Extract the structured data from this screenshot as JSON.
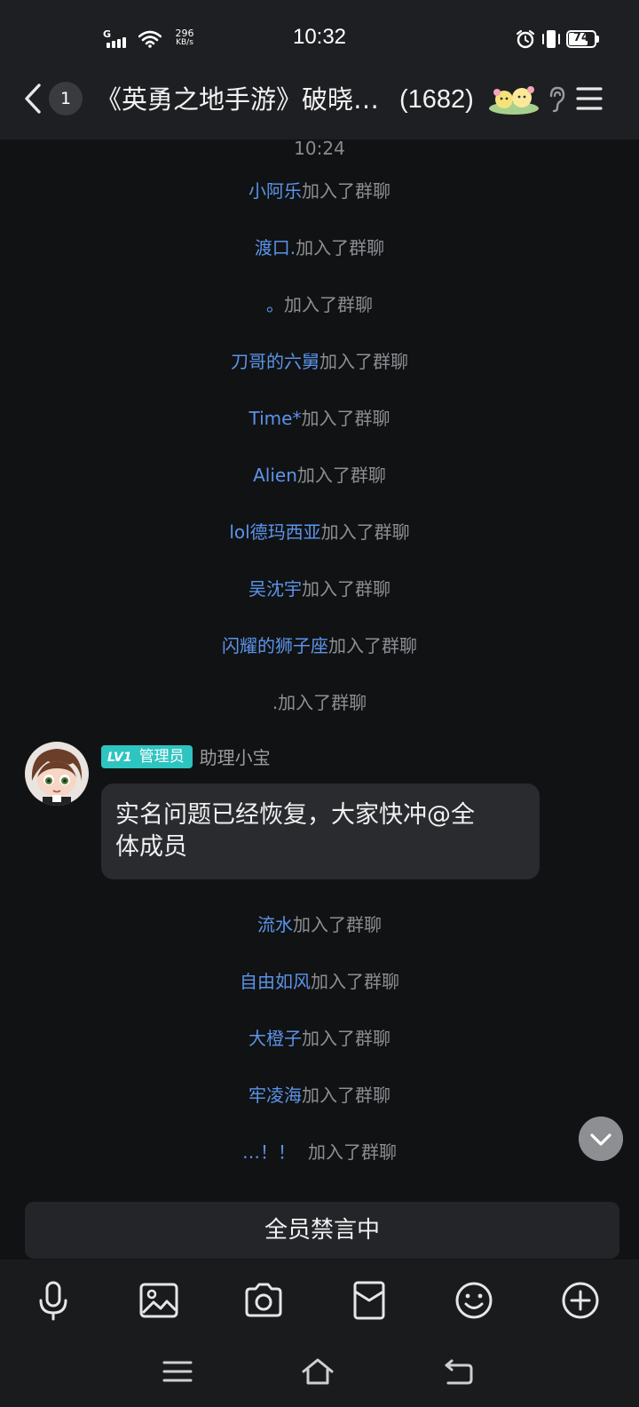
{
  "status_bar": {
    "network": "G",
    "net_speed": "296",
    "net_speed_unit": "KB/s",
    "time": "10:32",
    "battery": "74",
    "battery_level": 0.74
  },
  "title_bar": {
    "unread_count": "1",
    "group_name": "《英勇之地手游》破晓…",
    "member_count": "(1682)"
  },
  "chat": {
    "timestamp": "10:24",
    "join_suffix": "加入了群聊",
    "joins_before": [
      "小阿乐",
      "渡口.",
      "。",
      "刀哥的六舅",
      "Time*",
      "Alien",
      "lol德玛西亚",
      "吴沈宇",
      "闪耀的狮子座",
      "."
    ],
    "message": {
      "level": "LV1",
      "role": "管理员",
      "sender": "助理小宝",
      "text_line1": "实名问题已经恢复，大家快冲@全",
      "text_line2": "体成员"
    },
    "joins_after": [
      "流水",
      "自由如风",
      "大橙子",
      "牢凌海",
      "…！！"
    ]
  },
  "bottom": {
    "mute_notice": "全员禁言中"
  },
  "colors": {
    "nickname": "#5b94e8",
    "badge": "#2ec4c0",
    "background": "#111214"
  }
}
